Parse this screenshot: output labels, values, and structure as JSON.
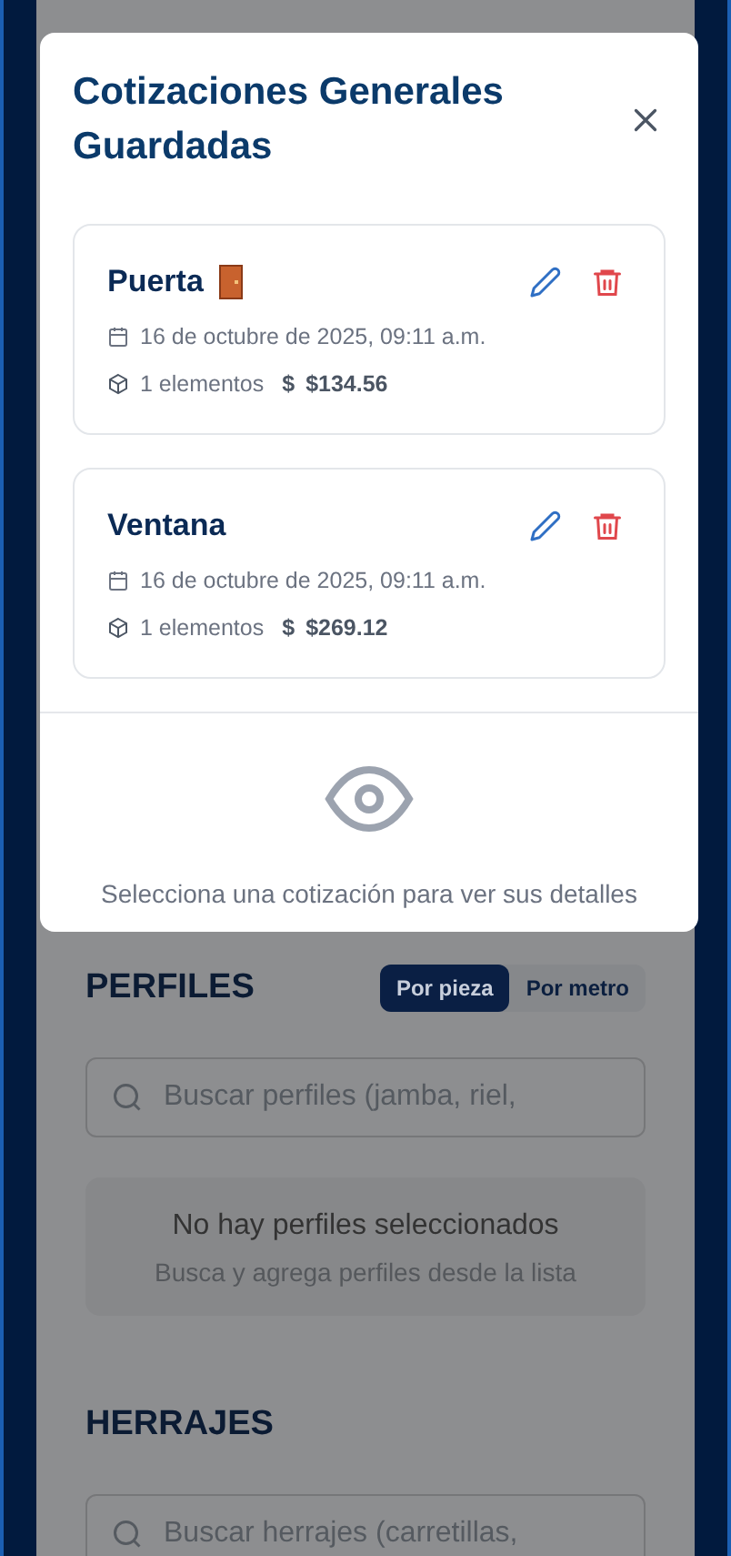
{
  "modal": {
    "title": "Cotizaciones Generales Guardadas",
    "quotes": [
      {
        "name": "Puerta",
        "kind": "door",
        "date": "16 de octubre de 2025, 09:11 a.m.",
        "items": "1 elementos",
        "currency_symbol": "$",
        "total": "$134.56"
      },
      {
        "name": "Ventana",
        "kind": "plain",
        "date": "16 de octubre de 2025, 09:11 a.m.",
        "items": "1 elementos",
        "currency_symbol": "$",
        "total": "$269.12"
      }
    ],
    "empty_message": "Selecciona una cotización para ver sus detalles"
  },
  "sections": [
    {
      "title": "PERFILES",
      "toggle": [
        {
          "label": "Por pieza",
          "selected": true
        },
        {
          "label": "Por metro",
          "selected": false
        }
      ],
      "search": {
        "placeholder": "Buscar perfiles (jamba, riel,"
      },
      "empty": {
        "title": "No hay perfiles seleccionados",
        "hint": "Busca y agrega perfiles desde la lista"
      }
    },
    {
      "title": "HERRAJES",
      "search": {
        "placeholder": "Buscar herrajes (carretillas,"
      }
    }
  ]
}
